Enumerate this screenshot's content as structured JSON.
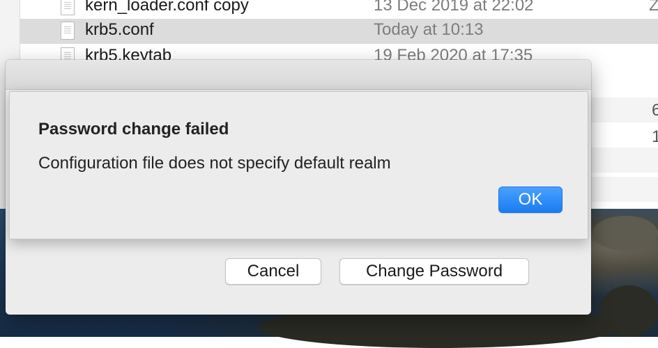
{
  "finder": {
    "rows": [
      {
        "name": "kern_loader.conf copy",
        "date": "13 Dec 2019 at 22:02",
        "extra": "Z"
      },
      {
        "name": "krb5.conf",
        "date": "Today at 10:13",
        "extra": ""
      },
      {
        "name": "krb5.keytab",
        "date": "19 Feb 2020 at 17:35",
        "extra": ""
      }
    ],
    "right_strip": [
      "6",
      "1"
    ]
  },
  "sheet": {
    "cancel_label": "Cancel",
    "change_password_label": "Change Password"
  },
  "alert": {
    "title": "Password change failed",
    "message": "Configuration file does not specify default realm",
    "ok_label": "OK"
  },
  "colors": {
    "accent": "#1a7cf2",
    "selection": "#dcdcdc",
    "dialog_bg": "#ececec"
  }
}
